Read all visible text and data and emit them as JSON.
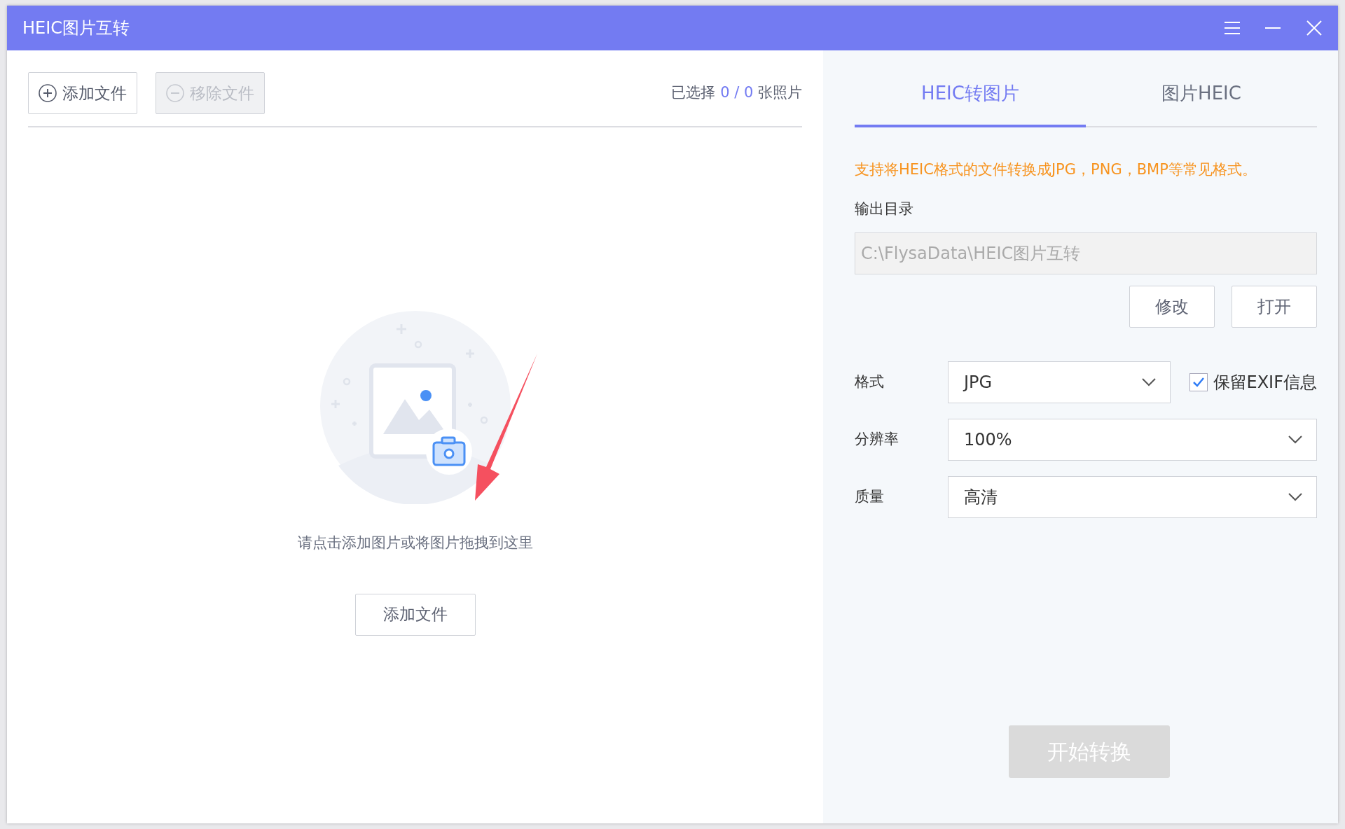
{
  "window": {
    "title": "HEIC图片互转"
  },
  "toolbar": {
    "buttons": [
      {
        "label": "添加文件",
        "kind": "add",
        "disabled": false
      },
      {
        "label": "移除文件",
        "kind": "remove",
        "disabled": true
      }
    ],
    "selection": {
      "prefix": "已选择",
      "selected": "0",
      "separator": "/",
      "total": "0",
      "suffix": "张照片"
    }
  },
  "drop_zone": {
    "hint": "请点击添加图片或将图片拖拽到这里",
    "button": "添加文件"
  },
  "tabs": [
    {
      "label": "HEIC转图片",
      "selected": true
    },
    {
      "label": "图片HEIC",
      "selected": false
    }
  ],
  "notice": "支持将HEIC格式的文件转换成JPG，PNG，BMP等常见格式。",
  "output": {
    "label": "输出目录",
    "value": "C:\\FlysaData\\HEIC图片互转",
    "buttons": [
      "修改",
      "打开"
    ]
  },
  "settings": [
    {
      "label": "格式",
      "value": "JPG",
      "checkbox": {
        "label": "保留EXIF信息",
        "checked": true
      }
    },
    {
      "label": "分辨率",
      "value": "100%"
    },
    {
      "label": "质量",
      "value": "高清"
    }
  ],
  "start_button": {
    "label": "开始转换",
    "disabled": true
  }
}
